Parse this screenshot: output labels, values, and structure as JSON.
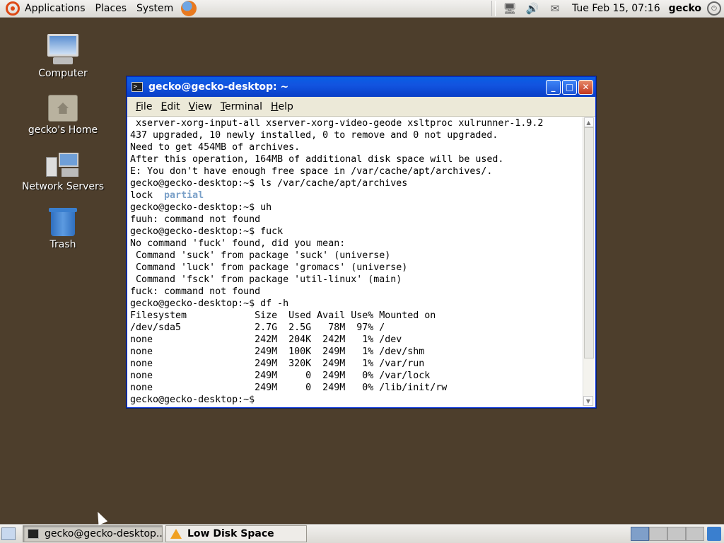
{
  "top_panel": {
    "menus": [
      "Applications",
      "Places",
      "System"
    ],
    "clock": "Tue Feb 15, 07:16",
    "username": "gecko"
  },
  "desktop_icons": [
    {
      "label": "Computer",
      "icon": "computer-icon"
    },
    {
      "label": "gecko's Home",
      "icon": "home-folder-icon"
    },
    {
      "label": "Network Servers",
      "icon": "network-servers-icon"
    },
    {
      "label": "Trash",
      "icon": "trash-icon"
    }
  ],
  "terminal": {
    "title": "gecko@gecko-desktop: ~",
    "menu": [
      "File",
      "Edit",
      "View",
      "Terminal",
      "Help"
    ],
    "menu_accel": [
      "F",
      "E",
      "V",
      "T",
      "H"
    ],
    "lines": [
      " xserver-xorg-input-all xserver-xorg-video-geode xsltproc xulrunner-1.9.2",
      "437 upgraded, 10 newly installed, 0 to remove and 0 not upgraded.",
      "Need to get 454MB of archives.",
      "After this operation, 164MB of additional disk space will be used.",
      "E: You don't have enough free space in /var/cache/apt/archives/.",
      "gecko@gecko-desktop:~$ ls /var/cache/apt/archives",
      "lock  ",
      "gecko@gecko-desktop:~$ uh",
      "fuuh: command not found",
      "gecko@gecko-desktop:~$ fuck",
      "No command 'fuck' found, did you mean:",
      " Command 'suck' from package 'suck' (universe)",
      " Command 'luck' from package 'gromacs' (universe)",
      " Command 'fsck' from package 'util-linux' (main)",
      "fuck: command not found",
      "gecko@gecko-desktop:~$ df -h",
      "Filesystem            Size  Used Avail Use% Mounted on",
      "/dev/sda5             2.7G  2.5G   78M  97% /",
      "none                  242M  204K  242M   1% /dev",
      "none                  249M  100K  249M   1% /dev/shm",
      "none                  249M  320K  249M   1% /var/run",
      "none                  249M     0  249M   0% /var/lock",
      "none                  249M     0  249M   0% /lib/init/rw",
      "gecko@gecko-desktop:~$ "
    ],
    "partial_dir": "partial",
    "icon_glyph": ">_"
  },
  "taskbar": {
    "tasks": [
      {
        "label": "gecko@gecko-desktop...",
        "icon": "terminal-icon",
        "active": true
      },
      {
        "label": "Low Disk Space",
        "icon": "warning-icon",
        "active": false
      }
    ]
  },
  "window_buttons": {
    "minimize": "_",
    "maximize": "□",
    "close": "✕"
  },
  "colors": {
    "desktop_bg": "#4d3e2c",
    "titlebar": "#0a5ee4",
    "partial_dir": "#7aa0c8"
  }
}
